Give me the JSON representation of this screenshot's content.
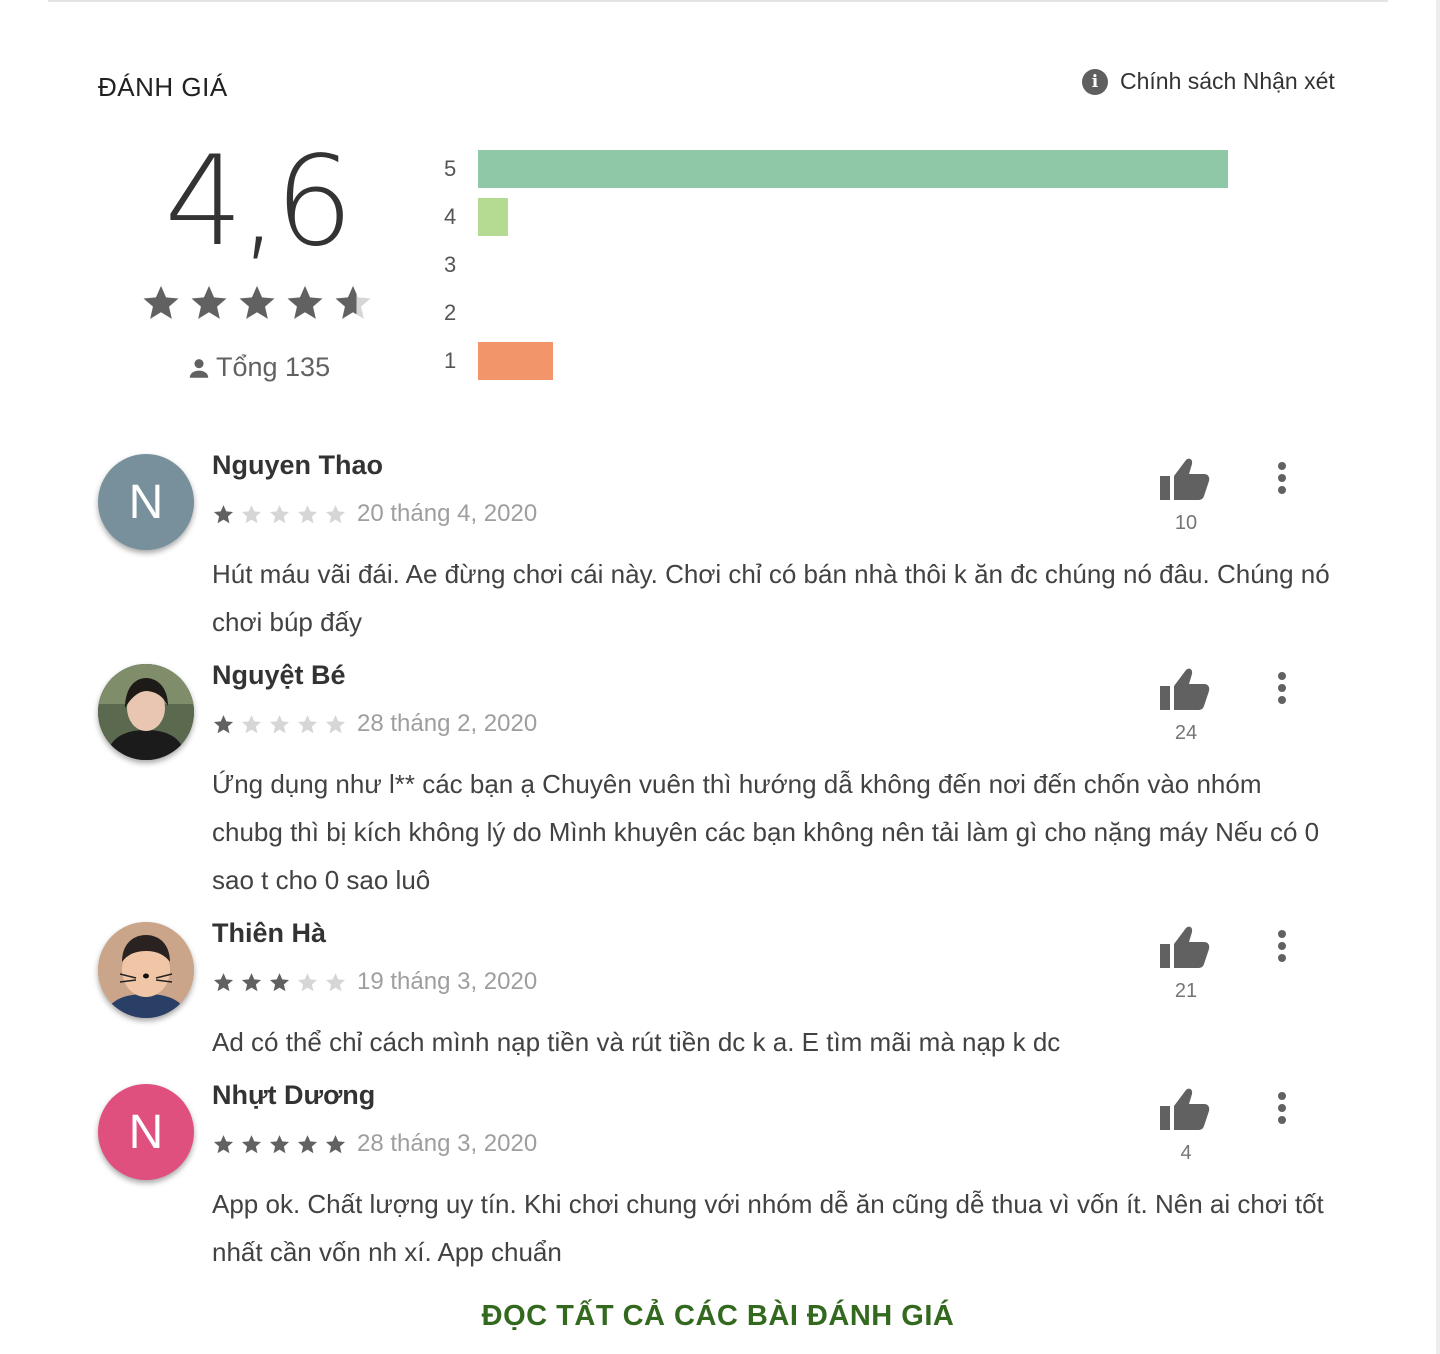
{
  "header": {
    "title": "ĐÁNH GIÁ",
    "policy_label": "Chính sách Nhận xét"
  },
  "summary": {
    "score": "4,6",
    "stars": 4.6,
    "total_label": "Tổng 135"
  },
  "histogram": {
    "rows": [
      {
        "label": "5",
        "fraction": 1.0,
        "color": "#8fc8a6"
      },
      {
        "label": "4",
        "fraction": 0.04,
        "color": "#b5da92"
      },
      {
        "label": "3",
        "fraction": 0.0,
        "color": "#fbd98f"
      },
      {
        "label": "2",
        "fraction": 0.0,
        "color": "#fbbf8f"
      },
      {
        "label": "1",
        "fraction": 0.1,
        "color": "#f3956a"
      }
    ]
  },
  "reviews": [
    {
      "author": "Nguyen Thao",
      "avatar_letter": "N",
      "avatar_color": "#78909c",
      "rating": 1,
      "date": "20 tháng 4, 2020",
      "text": "Hút máu vãi đái. Ae đừng chơi cái này. Chơi chỉ có bán nhà thôi k ăn đc chúng nó đâu. Chúng nó chơi búp đấy",
      "likes": "10"
    },
    {
      "author": "Nguyệt Bé",
      "avatar_letter": "",
      "avatar_color": "#3a3a3a",
      "rating": 1,
      "date": "28 tháng 2, 2020",
      "text": "Ứng dụng như l** các bạn ạ Chuyên vuên thì hướng dẫ không đến nơi đến chốn vào nhóm chubg thì bị kích không lý do Mình khuyên các bạn không nên tải làm gì cho nặng máy Nếu có 0 sao t cho 0 sao luô",
      "likes": "24"
    },
    {
      "author": "Thiên Hà",
      "avatar_letter": "",
      "avatar_color": "#d8a98a",
      "rating": 3,
      "date": "19 tháng 3, 2020",
      "text": "Ad có thể chỉ cách mình nạp tiền và rút tiền dc k a. E tìm mãi mà nạp k dc",
      "likes": "21"
    },
    {
      "author": "Nhựt Dương",
      "avatar_letter": "N",
      "avatar_color": "#e0507f",
      "rating": 5,
      "date": "28 tháng 3, 2020",
      "text": "App ok. Chất lượng uy tín. Khi chơi chung với nhóm dễ ăn cũng dễ thua vì vốn ít. Nên ai chơi tốt nhất cần vốn nh xí. App chuẩn",
      "likes": "4"
    }
  ],
  "footer": {
    "read_all_label": "ĐỌC TẤT CẢ CÁC BÀI ĐÁNH GIÁ"
  },
  "colors": {
    "star_filled": "#616161",
    "star_empty": "#d6d6d6",
    "accent_green": "#33691e"
  }
}
